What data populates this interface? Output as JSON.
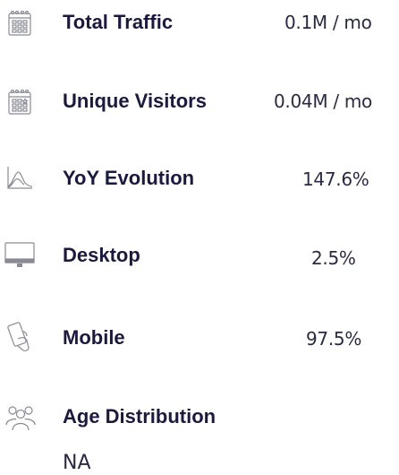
{
  "stats": [
    {
      "label": "Total Traffic",
      "value": "0.1M / mo",
      "icon": "calendar-icon"
    },
    {
      "label": "Unique Visitors",
      "value": "0.04M / mo",
      "icon": "calendar-star-icon"
    },
    {
      "label": "YoY Evolution",
      "value": "147.6%",
      "icon": "area-chart-icon"
    },
    {
      "label": "Desktop",
      "value": "2.5%",
      "icon": "monitor-icon"
    },
    {
      "label": "Mobile",
      "value": "97.5%",
      "icon": "mobile-hand-icon"
    }
  ],
  "age_distribution": {
    "label": "Age Distribution",
    "value": "NA",
    "icon": "people-group-icon"
  }
}
